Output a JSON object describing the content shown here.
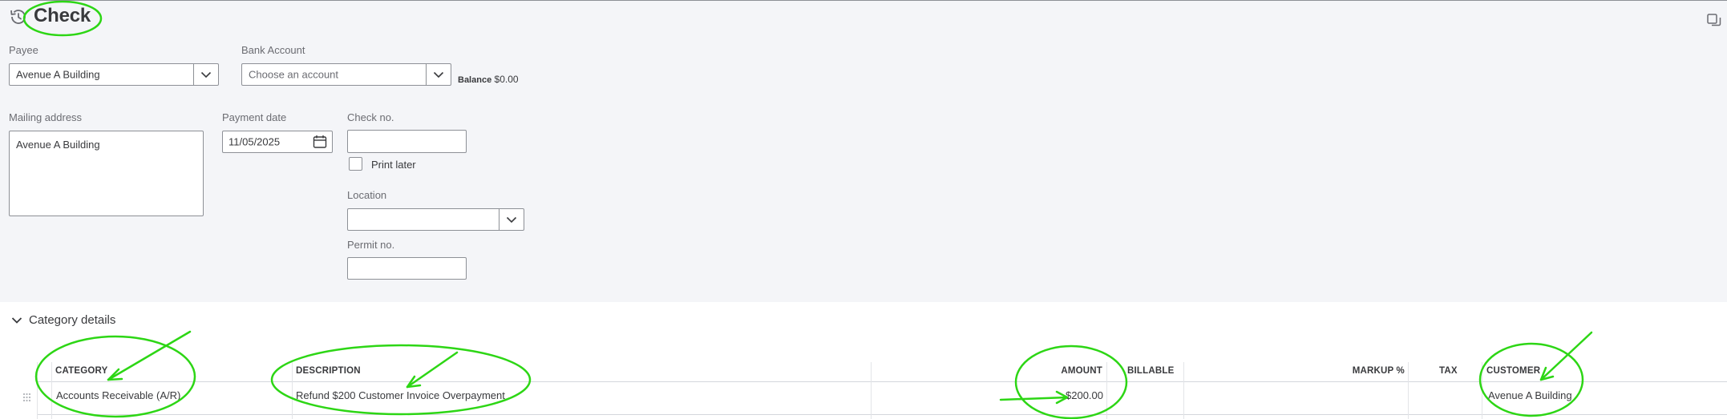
{
  "header": {
    "title": "Check"
  },
  "payee": {
    "label": "Payee",
    "value": "Avenue A Building"
  },
  "bank_account": {
    "label": "Bank Account",
    "placeholder": "Choose an account"
  },
  "balance": {
    "label": "Balance",
    "value": "$0.00"
  },
  "mailing_address": {
    "label": "Mailing address",
    "value": "Avenue A Building"
  },
  "payment_date": {
    "label": "Payment date",
    "value": "11/05/2025"
  },
  "check_no": {
    "label": "Check no.",
    "value": ""
  },
  "print_later": {
    "label": "Print later",
    "checked": false
  },
  "location": {
    "label": "Location",
    "value": ""
  },
  "permit_no": {
    "label": "Permit no.",
    "value": ""
  },
  "category_details": {
    "title": "Category details",
    "columns": {
      "category": "CATEGORY",
      "description": "DESCRIPTION",
      "amount": "AMOUNT",
      "billable": "BILLABLE",
      "markup": "MARKUP %",
      "tax": "TAX",
      "customer": "CUSTOMER"
    },
    "rows": [
      {
        "category": "Accounts Receivable (A/R)",
        "description": "Refund $200 Customer Invoice Overpayment",
        "amount": "$200.00",
        "customer": "Avenue A Building"
      }
    ]
  },
  "colors": {
    "annotation": "#2dd615",
    "border": "#8d9096",
    "panel": "#f4f5f8"
  },
  "icons": [
    "history-icon",
    "chevron-down-icon",
    "calendar-icon",
    "copy-icon",
    "drag-handle-icon"
  ]
}
